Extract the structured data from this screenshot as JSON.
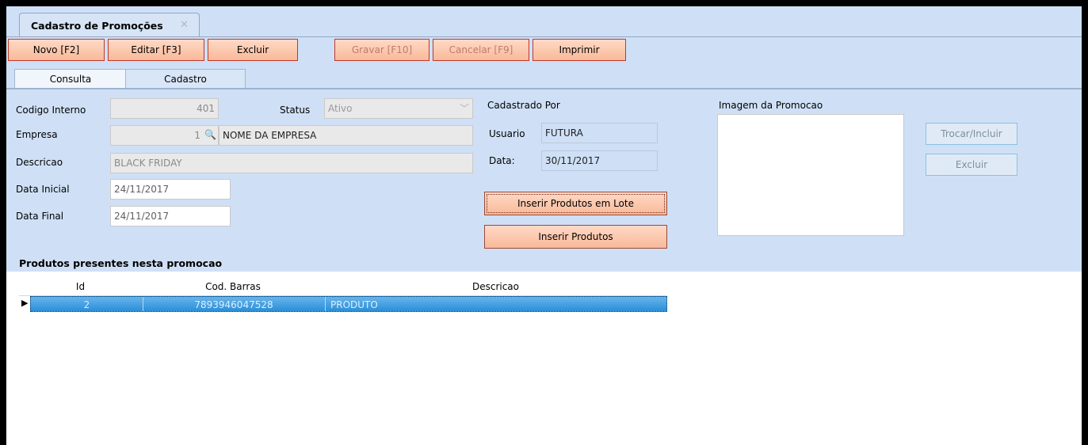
{
  "window": {
    "tab_title": "Cadastro de Promoções",
    "tab_close": "✕"
  },
  "toolbar": {
    "novo": "Novo [F2]",
    "editar": "Editar [F3]",
    "excluir": "Excluir",
    "gravar": "Gravar [F10]",
    "cancelar": "Cancelar [F9]",
    "imprimir": "Imprimir"
  },
  "tabs": {
    "consulta": "Consulta",
    "cadastro": "Cadastro"
  },
  "form": {
    "codigo_label": "Codigo Interno",
    "codigo_value": "401",
    "status_label": "Status",
    "status_value": "Ativo",
    "empresa_label": "Empresa",
    "empresa_code": "1",
    "empresa_name": "NOME DA EMPRESA",
    "descricao_label": "Descricao",
    "descricao_value": "BLACK FRIDAY",
    "data_inicial_label": "Data Inicial",
    "data_inicial_value": "24/11/2017",
    "data_final_label": "Data Final",
    "data_final_value": "24/11/2017"
  },
  "cadastrado": {
    "title": "Cadastrado Por",
    "usuario_label": "Usuario",
    "usuario_value": "FUTURA",
    "data_label": "Data:",
    "data_value": "30/11/2017"
  },
  "actions": {
    "inserir_lote": "Inserir Produtos em Lote",
    "inserir": "Inserir Produtos"
  },
  "image": {
    "title": "Imagem da Promocao",
    "trocar": "Trocar/Incluir",
    "excluir": "Excluir"
  },
  "products": {
    "title": "Produtos presentes nesta promocao",
    "columns": [
      "Id",
      "Cod. Barras",
      "Descricao"
    ],
    "rows": [
      {
        "id": "2",
        "barcode": "7893946047528",
        "descricao": "PRODUTO"
      }
    ]
  }
}
